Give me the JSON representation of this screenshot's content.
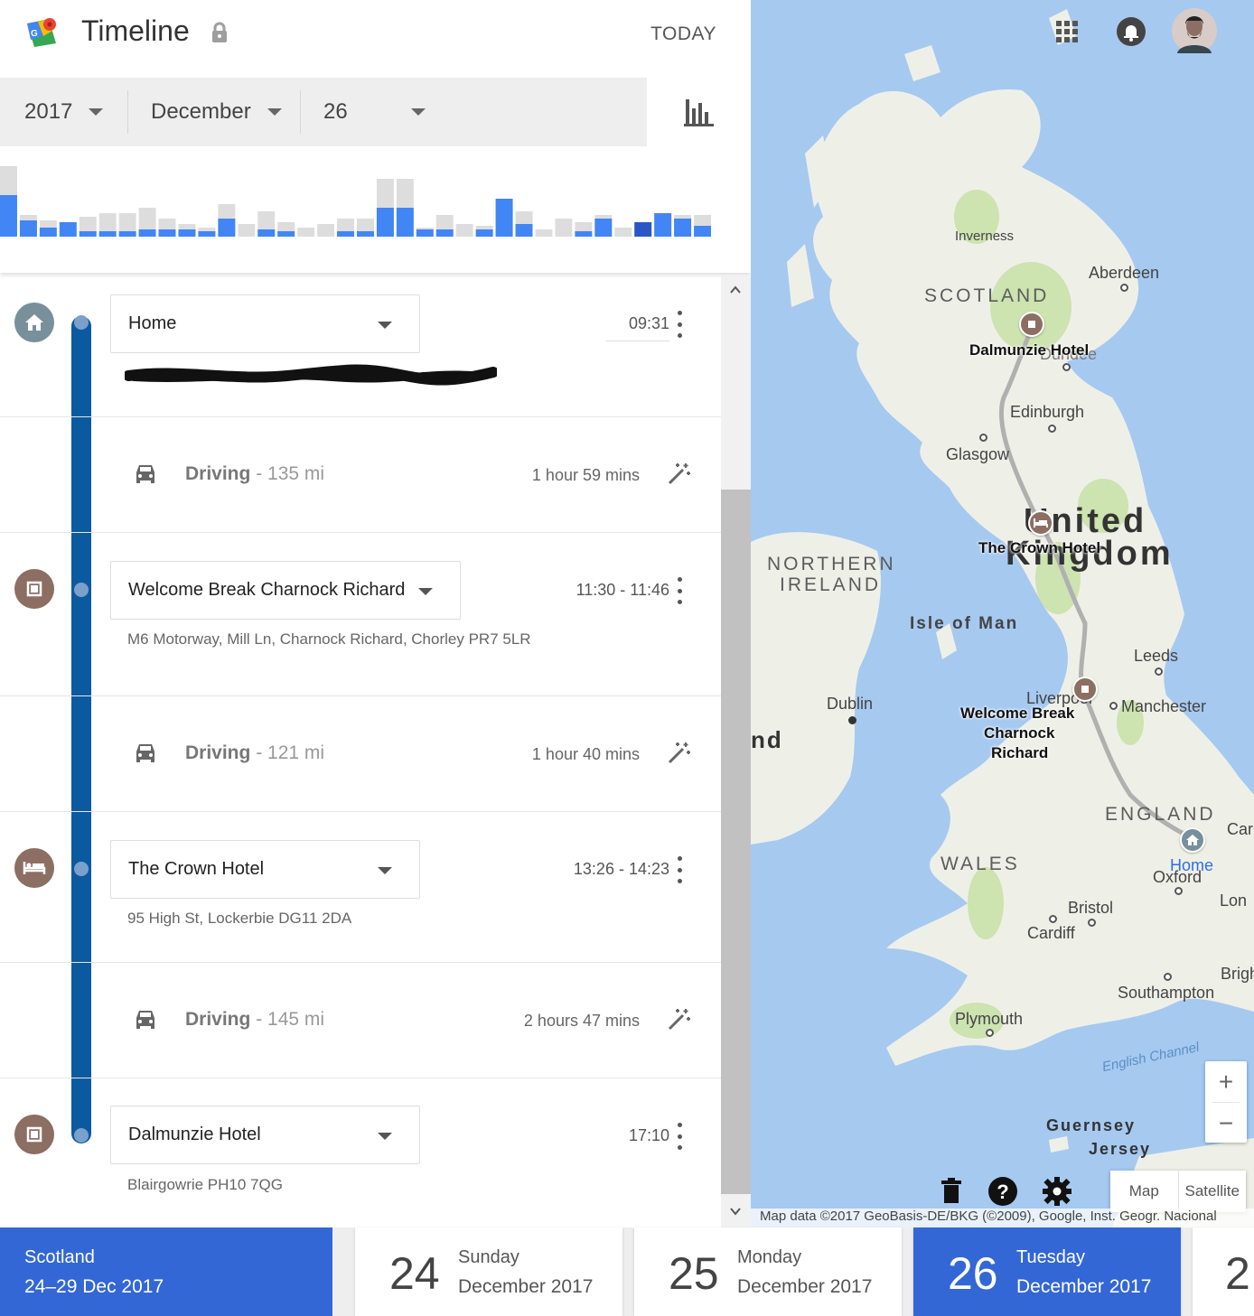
{
  "header": {
    "title": "Timeline",
    "today_label": "TODAY"
  },
  "date_selector": {
    "year": "2017",
    "month": "December",
    "day": "26"
  },
  "histogram": {
    "bars": [
      [
        0.78,
        0.46
      ],
      [
        0.24,
        0.18
      ],
      [
        0.18,
        0.1
      ],
      [
        0.16,
        0.16
      ],
      [
        0.22,
        0.06
      ],
      [
        0.26,
        0.06
      ],
      [
        0.26,
        0.06
      ],
      [
        0.32,
        0.08
      ],
      [
        0.2,
        0.08
      ],
      [
        0.14,
        0.08
      ],
      [
        0.1,
        0.06
      ],
      [
        0.36,
        0.2
      ],
      [
        0.14,
        0.0
      ],
      [
        0.28,
        0.08
      ],
      [
        0.16,
        0.06
      ],
      [
        0.1,
        0.0
      ],
      [
        0.14,
        0.0
      ],
      [
        0.2,
        0.06
      ],
      [
        0.2,
        0.06
      ],
      [
        0.64,
        0.32
      ],
      [
        0.64,
        0.32
      ],
      [
        0.1,
        0.08
      ],
      [
        0.24,
        0.08
      ],
      [
        0.14,
        0.0
      ],
      [
        0.12,
        0.08
      ],
      [
        0.42,
        0.42
      ],
      [
        0.28,
        0.14
      ],
      [
        0.08,
        0.0
      ],
      [
        0.2,
        0.0
      ],
      [
        0.16,
        0.06
      ],
      [
        0.24,
        0.2
      ],
      [
        0.1,
        0.0
      ],
      [
        0.16,
        0.16
      ],
      [
        0.26,
        0.26
      ],
      [
        0.24,
        0.2
      ],
      [
        0.24,
        0.12
      ]
    ],
    "selected_index": 32,
    "colors": {
      "bg": "#dddddd",
      "fg": "#4285f4",
      "selected": "#2a56c6"
    }
  },
  "timeline": {
    "places": [
      {
        "name": "Home",
        "time": "09:31",
        "address": "",
        "icon": "home-icon"
      },
      {
        "name": "Welcome Break Charnock Richard",
        "time": "11:30 - 11:46",
        "address": "M6 Motorway, Mill Ln, Charnock Richard, Chorley PR7 5LR",
        "icon": "stop-icon"
      },
      {
        "name": "The Crown Hotel",
        "time": "13:26 - 14:23",
        "address": "95 High St, Lockerbie DG11 2DA",
        "icon": "bed-icon"
      },
      {
        "name": "Dalmunzie Hotel",
        "time": "17:10",
        "address": "Blairgowrie PH10 7QG",
        "icon": "stop-icon"
      }
    ],
    "drives": [
      {
        "mode": "Driving",
        "distance": "- 135 mi",
        "duration": "1 hour 59 mins"
      },
      {
        "mode": "Driving",
        "distance": "- 121 mi",
        "duration": "1 hour 40 mins"
      },
      {
        "mode": "Driving",
        "distance": "- 145 mi",
        "duration": "2 hours 47 mins"
      }
    ]
  },
  "map": {
    "labels": {
      "inverness": "Inverness",
      "aberdeen": "Aberdeen",
      "scotland": "SCOTLAND",
      "dalmunzie": "Dalmunzie Hotel",
      "dundee": "Dundee",
      "edinburgh": "Edinburgh",
      "glasgow": "Glasgow",
      "united": "United",
      "kingdom": "Kingdom",
      "crown": "The Crown Hotel",
      "northern": "NORTHERN",
      "ireland": "IRELAND",
      "isle_of_man": "Isle of Man",
      "leeds": "Leeds",
      "dublin": "Dublin",
      "liverpool": "Liverpool",
      "manchester": "Manchester",
      "welcome_1": "Welcome Break",
      "welcome_2": "Charnock",
      "welcome_3": "Richard",
      "nd": "nd",
      "england": "ENGLAND",
      "car": "Car",
      "wales": "WALES",
      "home": "Home",
      "oxford": "Oxford",
      "lon": "Lon",
      "bristol": "Bristol",
      "cardiff": "Cardiff",
      "brigh": "Brigh",
      "southampton": "Southampton",
      "plymouth": "Plymouth",
      "english_channel": "English Channel",
      "guernsey": "Guernsey",
      "jersey": "Jersey"
    },
    "zoom_in": "+",
    "zoom_out": "−",
    "type_map": "Map",
    "type_satellite": "Satellite",
    "attribution": "Map data ©2017 GeoBasis-DE/BKG (©2009), Google, Inst. Geogr. Nacional",
    "colors": {
      "water": "#a6c9f0",
      "land": "#eef0e8",
      "park": "#cde3b0",
      "route": "#b0b0b0",
      "pin": "#8d6e63"
    }
  },
  "bottom": {
    "trip": {
      "title": "Scotland",
      "range": "24–29 Dec 2017"
    },
    "days": [
      {
        "num": "24",
        "dow": "Sunday",
        "month": "December 2017"
      },
      {
        "num": "25",
        "dow": "Monday",
        "month": "December 2017"
      },
      {
        "num": "26",
        "dow": "Tuesday",
        "month": "December 2017"
      },
      {
        "num": "2",
        "dow": "",
        "month": ""
      }
    ]
  },
  "colors": {
    "accent": "#3367d6",
    "spine": "#0b5aa0",
    "pin_brown": "#8d6e63",
    "home_grey": "#78909c"
  }
}
